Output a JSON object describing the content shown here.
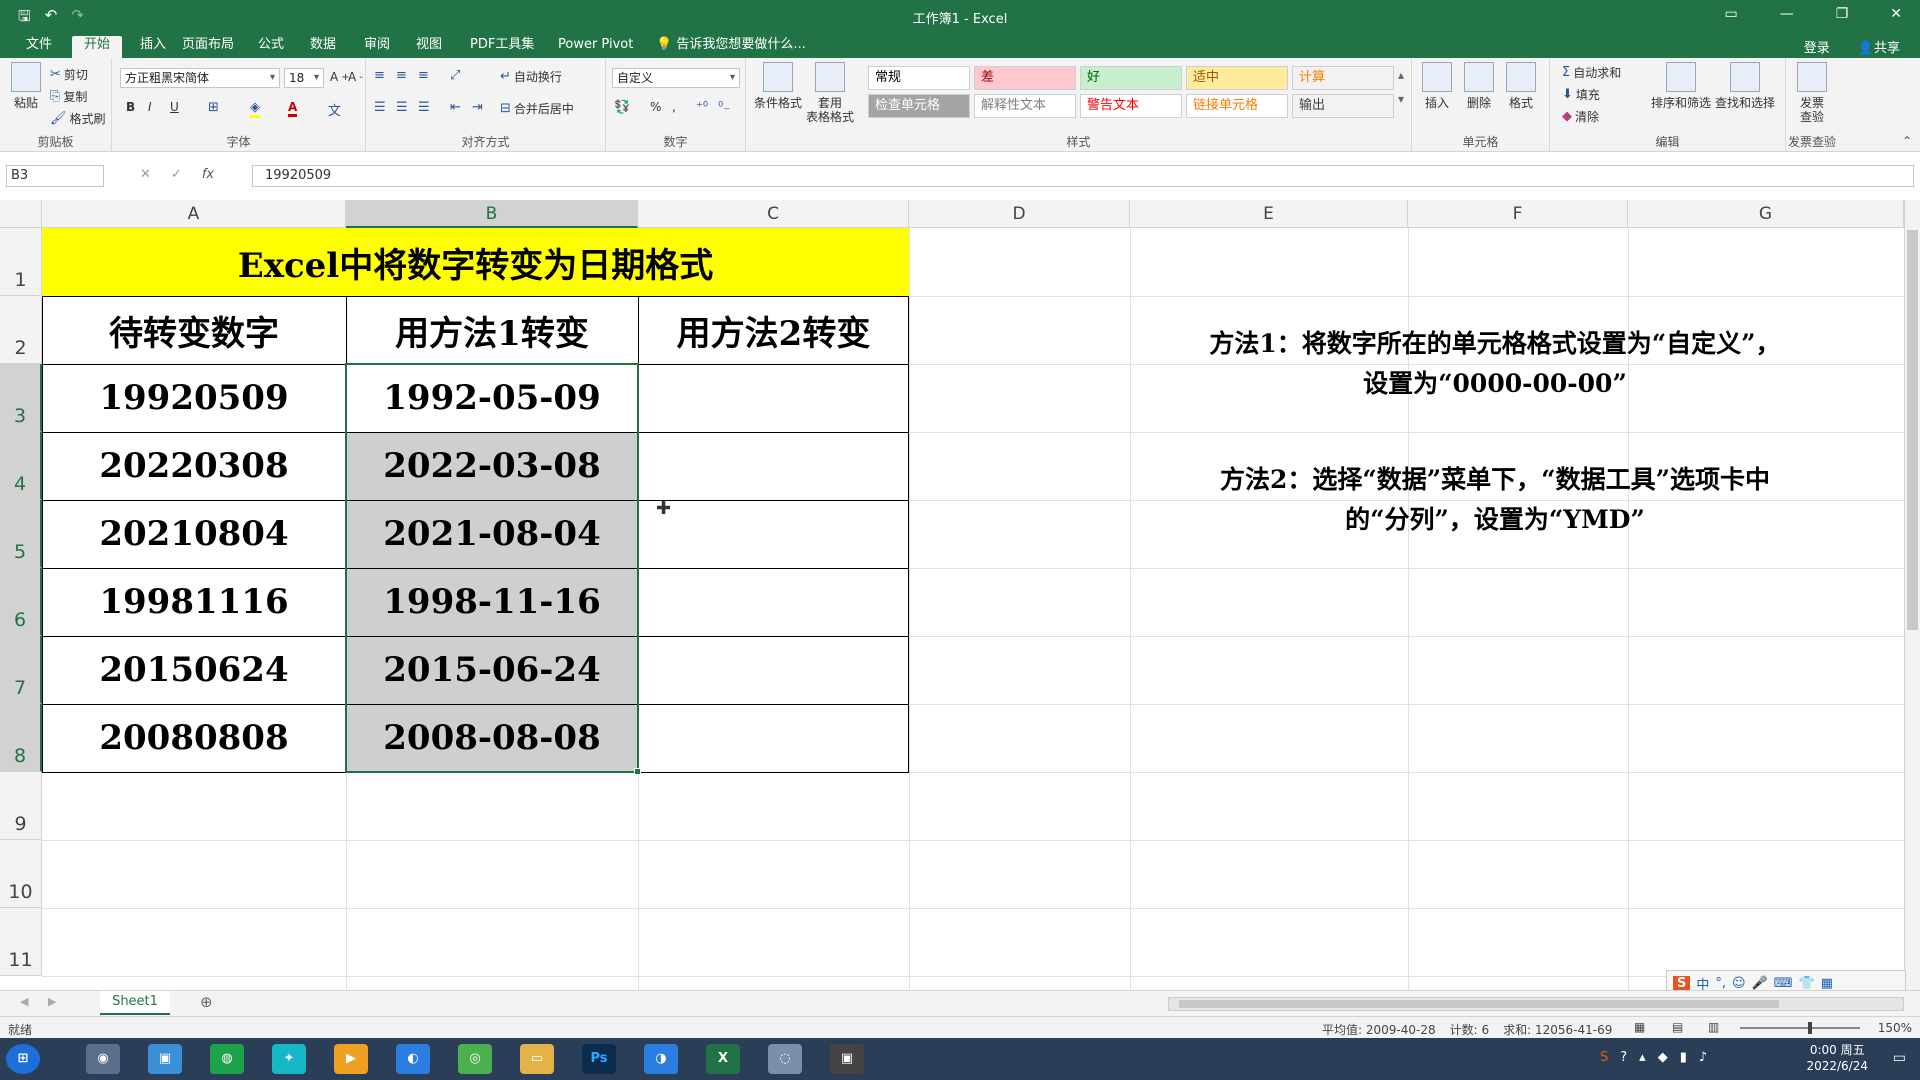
{
  "window": {
    "title": "工作簿1 - Excel"
  },
  "tabs": [
    "文件",
    "开始",
    "插入",
    "页面布局",
    "公式",
    "数据",
    "审阅",
    "视图",
    "PDF工具集",
    "Power Pivot"
  ],
  "tell_me": "告诉我您想要做什么...",
  "account": {
    "login": "登录",
    "share": "共享"
  },
  "ribbon": {
    "clipboard": {
      "label": "剪贴板",
      "paste": "粘贴",
      "cut": "剪切",
      "copy": "复制",
      "format_painter": "格式刷"
    },
    "font": {
      "label": "字体",
      "name": "方正粗黑宋简体",
      "size": "18",
      "bold": "B",
      "italic": "I",
      "underline": "U"
    },
    "alignment": {
      "label": "对齐方式",
      "wrap": "自动换行",
      "merge": "合并后居中"
    },
    "number": {
      "label": "数字",
      "format": "自定义"
    },
    "styles": {
      "label": "样式",
      "conditional": "条件格式",
      "table": "套用\n表格格式",
      "cells": [
        {
          "name": "常规",
          "bg": "#ffffff",
          "fg": "#000000"
        },
        {
          "name": "差",
          "bg": "#ffc7ce",
          "fg": "#9c0006"
        },
        {
          "name": "好",
          "bg": "#c6efce",
          "fg": "#006100"
        },
        {
          "name": "适中",
          "bg": "#ffeb9c",
          "fg": "#9c5700"
        },
        {
          "name": "计算",
          "bg": "#f2f2f2",
          "fg": "#fa7d00"
        },
        {
          "name": "检查单元格",
          "bg": "#a5a5a5",
          "fg": "#ffffff"
        },
        {
          "name": "解释性文本",
          "bg": "#ffffff",
          "fg": "#7f7f7f"
        },
        {
          "name": "警告文本",
          "bg": "#ffffff",
          "fg": "#ff0000"
        },
        {
          "name": "链接单元格",
          "bg": "#ffffff",
          "fg": "#fa7d00"
        },
        {
          "name": "输出",
          "bg": "#f2f2f2",
          "fg": "#3f3f3f"
        }
      ]
    },
    "cells": {
      "label": "单元格",
      "insert": "插入",
      "delete": "删除",
      "format": "格式"
    },
    "editing": {
      "label": "编辑",
      "autosum": "自动求和",
      "fill": "填充",
      "clear": "清除",
      "sort": "排序和筛选",
      "find": "查找和选择"
    },
    "invoice": {
      "label": "发票查验",
      "btn": "发票\n查验"
    }
  },
  "formula_bar": {
    "name_box": "B3",
    "value": "19920509"
  },
  "columns": [
    "A",
    "B",
    "C",
    "D",
    "E",
    "F",
    "G"
  ],
  "rows": [
    "1",
    "2",
    "3",
    "4",
    "5",
    "6",
    "7",
    "8",
    "9",
    "10",
    "11"
  ],
  "sheet": {
    "title": "Excel中将数字转变为日期格式",
    "headers": [
      "待转变数字",
      "用方法1转变",
      "用方法2转变"
    ],
    "data": [
      [
        "19920509",
        "1992-05-09",
        ""
      ],
      [
        "20220308",
        "2022-03-08",
        ""
      ],
      [
        "20210804",
        "2021-08-04",
        ""
      ],
      [
        "19981116",
        "1998-11-16",
        ""
      ],
      [
        "20150624",
        "2015-06-24",
        ""
      ],
      [
        "20080808",
        "2008-08-08",
        ""
      ]
    ],
    "note1_line1": "方法1：将数字所在的单元格格式设置为“自定义”，",
    "note1_line2": "设置为“0000-00-00”",
    "note2_line1": "方法2：选择“数据”菜单下，“数据工具”选项卡中",
    "note2_line2": "的“分列”，设置为“YMD”"
  },
  "sheet_tab": "Sheet1",
  "status": {
    "ready": "就绪",
    "average": "平均值: 2009-40-28",
    "count": "计数: 6",
    "sum": "求和: 12056-41-69",
    "zoom": "150%"
  },
  "taskbar": {
    "time": "0:00 周五",
    "date": "2022/6/24"
  },
  "colors": {
    "excel_green": "#217346",
    "title_fill": "#ffff00",
    "selection": "#cfcfcf"
  }
}
